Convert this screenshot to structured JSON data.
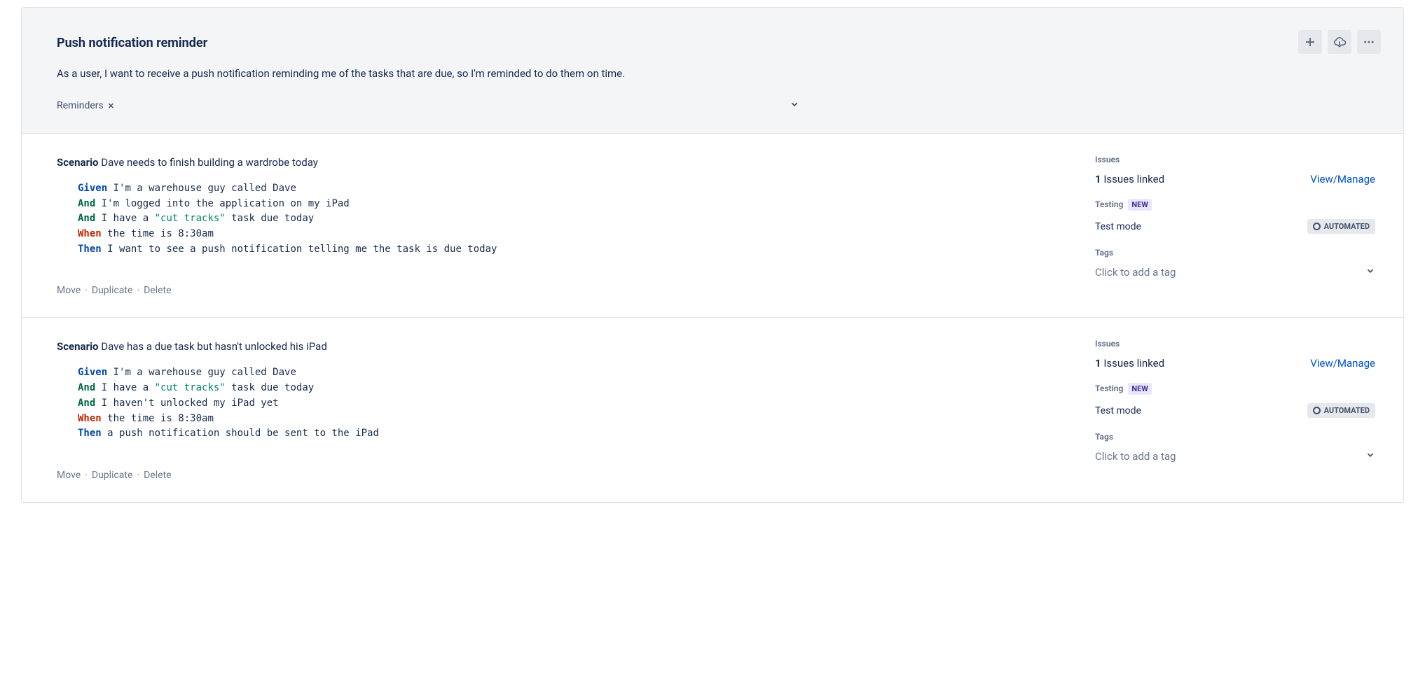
{
  "header": {
    "title": "Push notification reminder",
    "description": "As a user, I want to receive a push notification reminding me of the tasks that are due, so I'm reminded to do them on time.",
    "tag": "Reminders"
  },
  "labels": {
    "scenario": "Scenario",
    "issues": "Issues",
    "issues_linked": "Issues linked",
    "view_manage": "View/Manage",
    "testing": "Testing",
    "new_badge": "NEW",
    "test_mode": "Test mode",
    "automated": "AUTOMATED",
    "tags": "Tags",
    "add_tag": "Click to add a tag",
    "move": "Move",
    "duplicate": "Duplicate",
    "delete": "Delete"
  },
  "scenarios": [
    {
      "title": "Dave needs to finish building a wardrobe today",
      "steps": [
        {
          "kw": "Given",
          "kw_cls": "kw-given",
          "text": "I'm a warehouse guy called Dave"
        },
        {
          "kw": "And",
          "kw_cls": "kw-and",
          "text": "I'm logged into the application on my iPad"
        },
        {
          "kw": "And",
          "kw_cls": "kw-and",
          "pre": "I have a ",
          "str": "\"cut tracks\"",
          "post": " task due today"
        },
        {
          "kw": "When",
          "kw_cls": "kw-when",
          "text": "the time is 8:30am"
        },
        {
          "kw": "Then",
          "kw_cls": "kw-then",
          "text": "I want to see a push notification telling me the task is due today"
        }
      ],
      "issues_count": "1"
    },
    {
      "title": "Dave has a due task but hasn't unlocked his iPad",
      "steps": [
        {
          "kw": "Given",
          "kw_cls": "kw-given",
          "text": "I'm a warehouse guy called Dave"
        },
        {
          "kw": "And",
          "kw_cls": "kw-and",
          "pre": "I have a ",
          "str": "\"cut tracks\"",
          "post": " task due today"
        },
        {
          "kw": "And",
          "kw_cls": "kw-and",
          "text": "I haven't unlocked my iPad yet"
        },
        {
          "kw": "When",
          "kw_cls": "kw-when",
          "text": "the time is 8:30am"
        },
        {
          "kw": "Then",
          "kw_cls": "kw-then",
          "text": "a push notification should be sent to the iPad"
        }
      ],
      "issues_count": "1"
    }
  ]
}
